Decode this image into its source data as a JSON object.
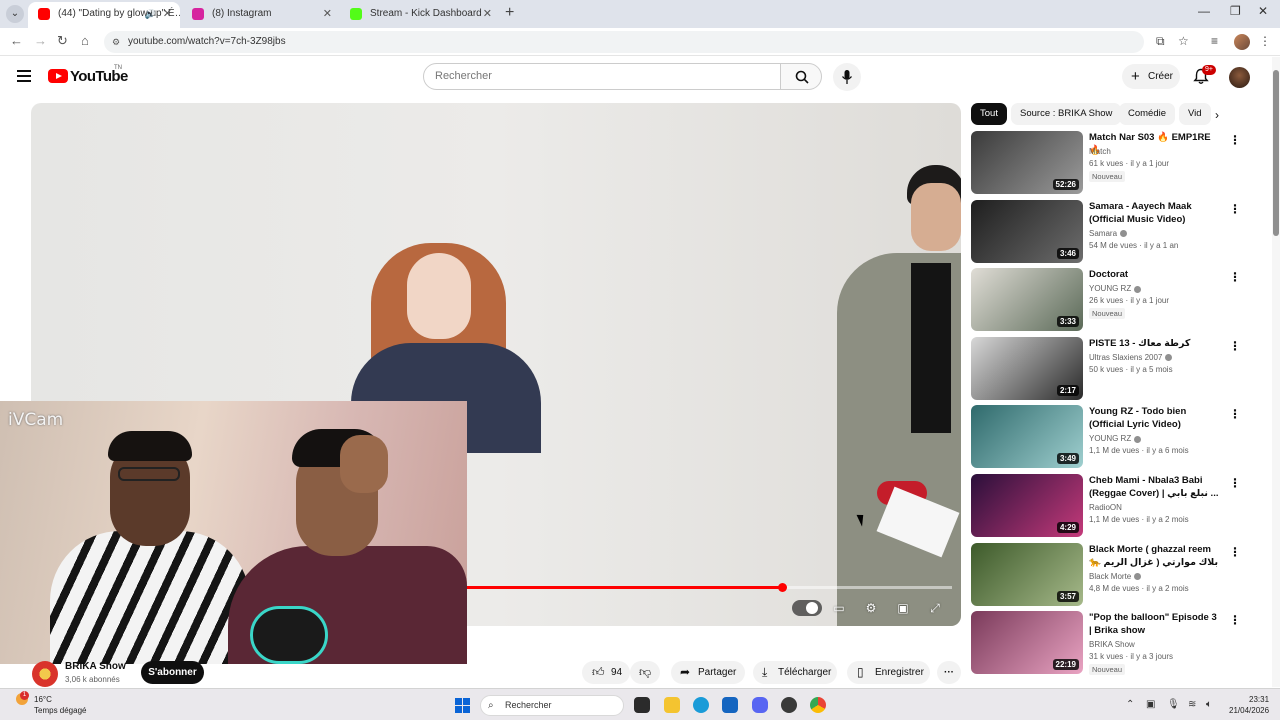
{
  "browser": {
    "tabs": [
      {
        "title": "(44) \"Dating by glow up\" É…",
        "favicon_color": "#ff0000",
        "active": true
      },
      {
        "title": "(8) Instagram",
        "favicon_color": "#d6249f",
        "active": false
      },
      {
        "title": "Stream - Kick Dashboard",
        "favicon_color": "#53fc18",
        "active": false
      }
    ],
    "new_tab": "+",
    "url": "youtube.com/watch?v=7ch-3Z98jbs"
  },
  "youtube": {
    "logo_text": "YouTube",
    "country_code": "TN",
    "search_placeholder": "Rechercher",
    "create_label": "Créer",
    "notification_count": "9+",
    "accent_color": "#ff0000"
  },
  "player": {
    "overlay_label": "iVCam",
    "progress": 0.65
  },
  "channel": {
    "name": "BRIKA Show",
    "subscribers": "3,06 k abonnés",
    "subscribe_label": "S'abonner"
  },
  "actions": {
    "likes": "94",
    "share": "Partager",
    "download": "Télécharger",
    "save": "Enregistrer",
    "more": "···"
  },
  "chips": [
    "Tout",
    "Source : BRIKA Show",
    "Comédie",
    "Vid"
  ],
  "recommendations": [
    {
      "title": "Match Nar S03 🔥 EMP1RE 🔥",
      "channel": "Match",
      "meta": "61 k vues · il y a 1 jour",
      "badge": "Nouveau",
      "duration": "52:26",
      "verified": false,
      "thumb": [
        "#3a3a3a",
        "#9b9b9b"
      ]
    },
    {
      "title": "Samara - Aayech Maak (Official Music Video)",
      "channel": "Samara",
      "meta": "54 M de vues · il y a 1 an",
      "badge": "",
      "duration": "3:46",
      "verified": true,
      "thumb": [
        "#1e1e1e",
        "#6d6d6d"
      ]
    },
    {
      "title": "Doctorat",
      "channel": "YOUNG RZ",
      "meta": "26 k vues · il y a 1 jour",
      "badge": "Nouveau",
      "duration": "3:33",
      "verified": true,
      "thumb": [
        "#e0ddd6",
        "#5b6a58"
      ]
    },
    {
      "title": "PISTE 13 - كرطة معاك",
      "channel": "Ultras Slaxiens 2007",
      "meta": "50 k vues · il y a 5 mois",
      "badge": "",
      "duration": "2:17",
      "verified": true,
      "thumb": [
        "#d8d8d8",
        "#2a2a2a"
      ]
    },
    {
      "title": "Young RZ - Todo bien (Official Lyric Video)",
      "channel": "YOUNG RZ",
      "meta": "1,1 M de vues · il y a 6 mois",
      "badge": "",
      "duration": "3:49",
      "verified": true,
      "thumb": [
        "#2f6a6c",
        "#9fcfcf"
      ]
    },
    {
      "title": "Cheb Mami - Nbala3 Babi (Reggae Cover) | نبلع بابي ...",
      "channel": "RadioON",
      "meta": "1,1 M de vues · il y a 2 mois",
      "badge": "",
      "duration": "4:29",
      "verified": false,
      "thumb": [
        "#2a0f3a",
        "#c43a7a"
      ]
    },
    {
      "title": "Black Morte ( ghazzal reem 🐆 غزال الريم ) بلاك موارتي",
      "channel": "Black Morte",
      "meta": "4,8 M de vues · il y a 2 mois",
      "badge": "",
      "duration": "3:57",
      "verified": true,
      "thumb": [
        "#3d5a2a",
        "#a6b98a"
      ]
    },
    {
      "title": "\"Pop the balloon\" Episode 3 | Brika show",
      "channel": "BRIKA Show",
      "meta": "31 k vues · il y a 3 jours",
      "badge": "Nouveau",
      "duration": "22:19",
      "verified": false,
      "thumb": [
        "#7a3a5a",
        "#e9a3c2"
      ]
    }
  ],
  "taskbar": {
    "temperature": "16°C",
    "weather": "Temps dégagé",
    "weather_badge": "1",
    "search_placeholder": "Rechercher",
    "time": "23:31",
    "date": "21/04/2026"
  }
}
